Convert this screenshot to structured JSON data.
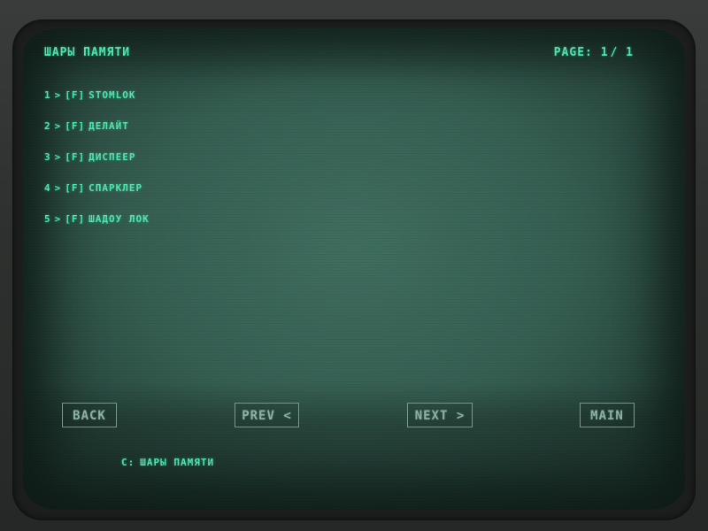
{
  "header": {
    "title": "ШАРЫ ПАМЯТИ",
    "page_label": "PAGE:",
    "page_current": "1",
    "page_separator": "/",
    "page_total": "1"
  },
  "items": [
    {
      "number": "1",
      "arrow": ">",
      "tag": "[F]",
      "name": "STOMLOK"
    },
    {
      "number": "2",
      "arrow": ">",
      "tag": "[F]",
      "name": "ДЕЛАЙТ"
    },
    {
      "number": "3",
      "arrow": ">",
      "tag": "[F]",
      "name": "ДИСПЕЕР"
    },
    {
      "number": "4",
      "arrow": ">",
      "tag": "[F]",
      "name": "СПАРКЛЕР"
    },
    {
      "number": "5",
      "arrow": ">",
      "tag": "[F]",
      "name": "ШАДОУ ЛОК"
    }
  ],
  "nav": {
    "back_label": "BACK",
    "prev_label": "PREV <",
    "next_label": "NEXT >",
    "main_label": "MAIN"
  },
  "status": {
    "prefix": "C:",
    "path": "ШАРЫ ПАМЯТИ"
  },
  "colors": {
    "text_primary": "#4fe8b0",
    "button_text": "#8fb3a8",
    "button_border": "#7e9a92",
    "screen_bg": "#3f6e5f",
    "bezel": "#2b2d2c"
  }
}
